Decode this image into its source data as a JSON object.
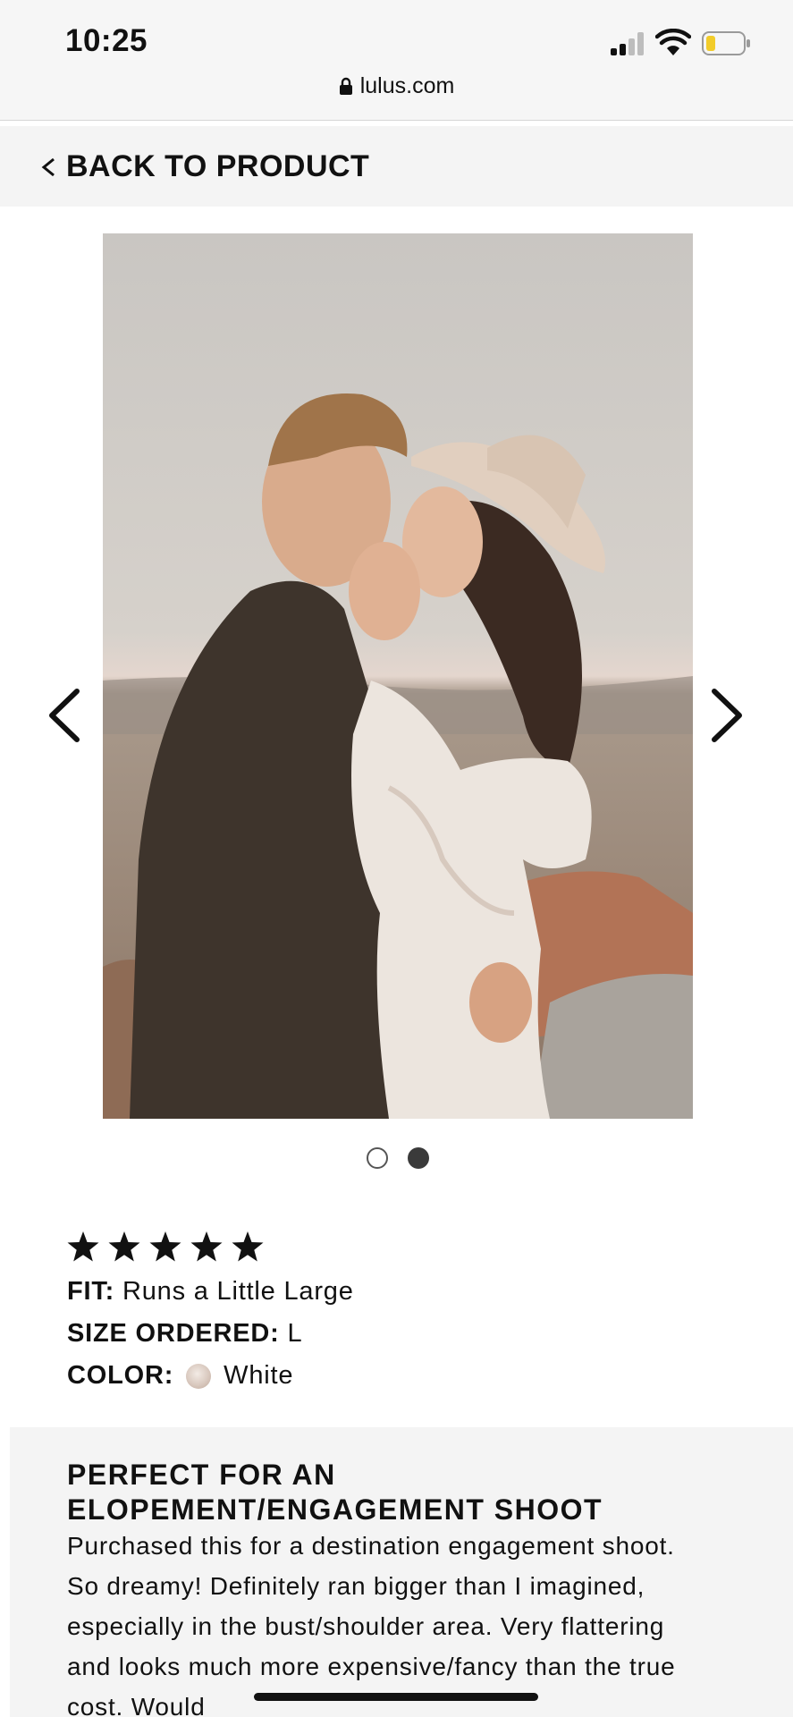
{
  "status_bar": {
    "time": "10:25",
    "url": "lulus.com",
    "icons": [
      "signal-icon",
      "wifi-icon",
      "battery-icon",
      "lock-icon"
    ]
  },
  "nav": {
    "back_label": "BACK TO PRODUCT",
    "icons": [
      "chevron-left-icon"
    ]
  },
  "carousel": {
    "photo_alt": "",
    "slide_count": 2,
    "active_slide": 2,
    "icons": [
      "arrow-left-icon",
      "arrow-right-icon"
    ]
  },
  "review": {
    "rating": 5,
    "rating_max": 5,
    "fit_label": "FIT:",
    "fit_value": "Runs a Little Large",
    "size_label": "SIZE ORDERED:",
    "size_value": "L",
    "color_label": "COLOR:",
    "color_value": "White",
    "color_swatch": "#e6d9d0",
    "title_line1": "PERFECT FOR AN",
    "title_line2": "ELOPEMENT/ENGAGEMENT SHOOT",
    "body": "Purchased this for a destination engagement shoot. So dreamy! Definitely ran bigger than I imagined, especially in the bust/shoulder area. Very flattering and looks much more expensive/fancy than the true cost. Would"
  },
  "colors": {
    "status_bg": "#f6f6f6",
    "back_bar_bg": "#f4f4f4",
    "review_bg": "#f4f4f4",
    "text": "#111111"
  }
}
